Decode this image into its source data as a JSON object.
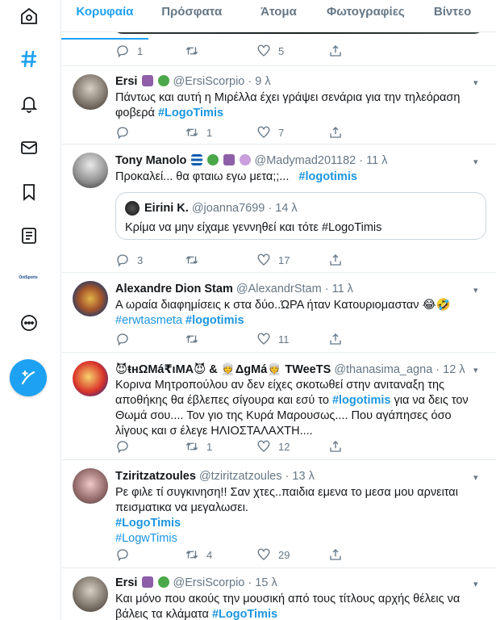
{
  "tabs": [
    "Κορυφαία",
    "Πρόσφατα",
    "Άτομα",
    "Φωτογραφίες",
    "Βίντεο"
  ],
  "nav": {
    "icons": [
      "home-icon",
      "explore-hashtag-icon",
      "notifications-bell-icon",
      "messages-envelope-icon",
      "bookmarks-icon",
      "lists-icon",
      "profile-avatar",
      "more-icon"
    ],
    "brand_text": "OniSports"
  },
  "colors": {
    "accent": "#1da1f2",
    "link": "#1b95e0",
    "muted": "#657786"
  },
  "top_actions": {
    "reply": "1",
    "retweet": "",
    "like": "5"
  },
  "tweets": [
    {
      "name": "Ersi",
      "handle": "@ErsiScorpio",
      "time": "9 λ",
      "body_text": "Πάντως και αυτή η Μιρέλλα έχει γράψει σενάρια για την τηλεόραση φοβερά",
      "hashtag": "#LogoTimis",
      "reply": "",
      "retweet": "1",
      "like": "7"
    },
    {
      "name": "Tony Manolo",
      "handle": "@Madymad201182",
      "time": "11 λ",
      "body_text": "Προκαλεί...  θα φταιω εγω μετα;;...",
      "hashtag": "#logotimis",
      "quote_name": "Eirini K.",
      "quote_handle": "@joanna7699",
      "quote_time": "14 λ",
      "quote_text": "Κρίμα να μην είχαμε γεννηθεί και τότε #LogoTimis",
      "reply": "3",
      "retweet": "",
      "like": "17"
    },
    {
      "name": "Alexandre Dion Stam",
      "handle": "@AlexandrStam",
      "time": "11 λ",
      "body_text": "Α ωραία διαφημίσεις κ στα δύο..ΏΡΑ ήταν Κατουριομασταν 😂🤣",
      "hashtag_plain": "#erwtasmeta",
      "hashtag": "#logotimis",
      "reply": "",
      "retweet": "",
      "like": "11"
    },
    {
      "name": "😈ŧнΩМá₹ιМΑ😈 & 👳ΔgΜá👳 TWeeTS",
      "handle": "@thanasima_agna",
      "time": "12 λ",
      "body_pre": "Κορινα Μητροπούλου αν δεν είχες σκοτωθεί στην ανιταναξη της αποθήκης θα έβλεπες σίγουρα και εσύ το",
      "hashtag": "#logotimis",
      "body_post": "για να δεις τον Θωμά σου.... Τον γιο της Κυρά Μαρουσως.... Που αγάπησες όσο λίγους και σ έλεγε ΗΛΙΟΣΤΑΛΑΧΤΗ....",
      "reply": "",
      "retweet": "1",
      "like": "12"
    },
    {
      "name": "Tziritzatzoules",
      "handle": "@tziritzatzoules",
      "time": "13 λ",
      "body_text": "Ρε φιλε τί συγκινηση!! Σαν χτες..παιδια εμενα το μεσα μου αρνειται πεισματικα να μεγαλωσει.",
      "hashtag": "#LogoTimis",
      "hashtag_plain": "#LogwTimis",
      "reply": "",
      "retweet": "4",
      "like": "29"
    },
    {
      "name": "Ersi",
      "handle": "@ErsiScorpio",
      "time": "15 λ",
      "body_text": "Και μόνο που ακούς την μουσική από τους τίτλους αρχής θέλεις να βάλεις τα κλάματα",
      "hashtag": "#LogoTimis"
    }
  ]
}
